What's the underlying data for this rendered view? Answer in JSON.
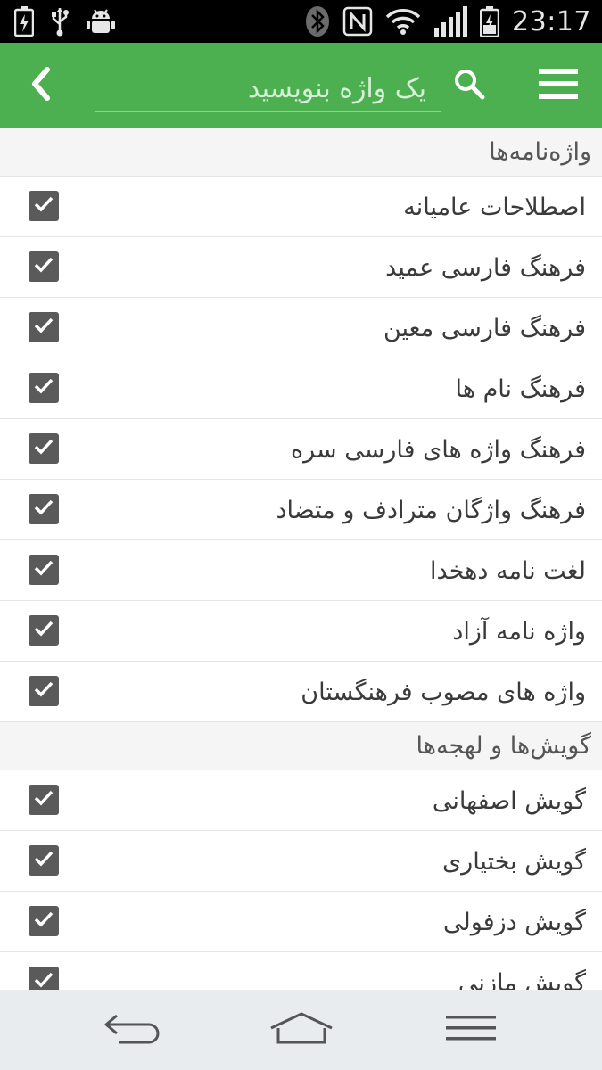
{
  "status_bar": {
    "time": "23:17",
    "left_icons": [
      "battery-charging-icon",
      "usb-icon",
      "android-debug-icon"
    ],
    "right_icons": [
      "bluetooth-icon",
      "nfc-icon",
      "wifi-icon",
      "signal-icon",
      "battery-icon"
    ]
  },
  "app_bar": {
    "background": "#4caf50",
    "search_placeholder": "یک واژه بنویسید",
    "icons": [
      "back-chevron-icon",
      "search-icon",
      "menu-icon"
    ]
  },
  "sections": [
    {
      "title": "واژه‌نامه‌ها",
      "items": [
        {
          "label": "اصطلاحات عامیانه",
          "checked": true
        },
        {
          "label": "فرهنگ فارسی عمید",
          "checked": true
        },
        {
          "label": "فرهنگ فارسی معین",
          "checked": true
        },
        {
          "label": "فرهنگ نام ها",
          "checked": true
        },
        {
          "label": "فرهنگ واژه های فارسی سره",
          "checked": true
        },
        {
          "label": "فرهنگ واژگان مترادف و متضاد",
          "checked": true
        },
        {
          "label": "لغت نامه دهخدا",
          "checked": true
        },
        {
          "label": "واژه نامه آزاد",
          "checked": true
        },
        {
          "label": "واژه های مصوب فرهنگستان",
          "checked": true
        }
      ]
    },
    {
      "title": "گویش‌ها و لهجه‌ها",
      "items": [
        {
          "label": "گویش اصفهانی",
          "checked": true
        },
        {
          "label": "گویش بختیاری",
          "checked": true
        },
        {
          "label": "گویش دزفولی",
          "checked": true
        },
        {
          "label": "گویش مازنی",
          "checked": true
        }
      ]
    }
  ],
  "nav_bar": {
    "icons": [
      "back-icon",
      "home-icon",
      "recent-apps-icon"
    ]
  }
}
